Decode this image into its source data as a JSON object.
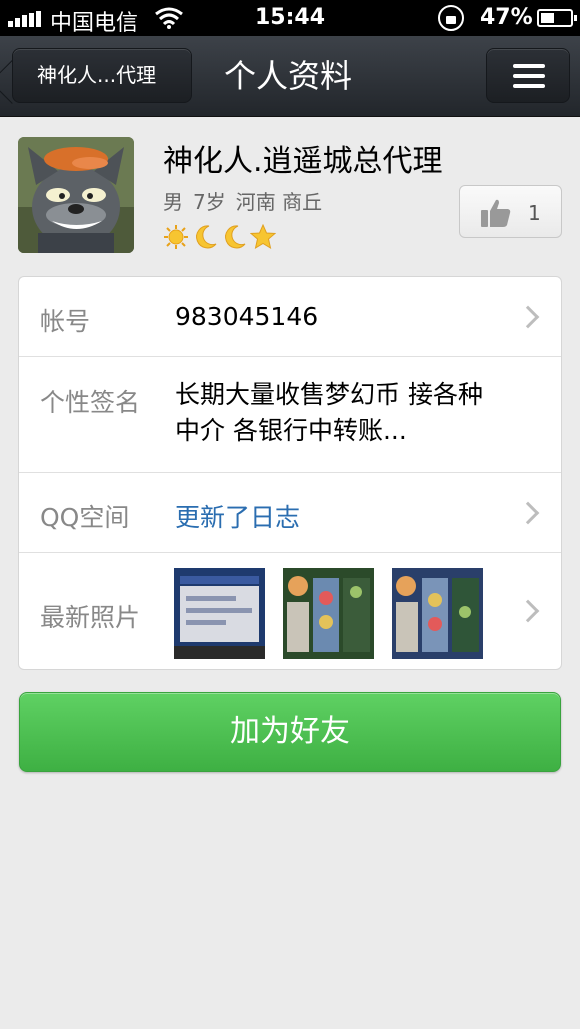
{
  "status_bar": {
    "carrier": "中国电信",
    "time": "15:44",
    "battery_percent": "47%",
    "battery_level": 0.47
  },
  "nav": {
    "back_label": "神化人...代理",
    "title": "个人资料",
    "menu_icon": "menu-icon"
  },
  "profile": {
    "name": "神化人.逍遥城总代理",
    "gender": "男",
    "age": "7岁",
    "location": "河南 商丘",
    "level_icons": [
      "sun-icon",
      "moon-icon",
      "moon-icon",
      "star-icon"
    ],
    "like_count": "1"
  },
  "details": {
    "account_label": "帐号",
    "account_value": "983045146",
    "signature_label": "个性签名",
    "signature_value": " 长期大量收售梦幻币 接各种中介 各银行中转账...",
    "qzone_label": "QQ空间",
    "qzone_value": "更新了日志",
    "photos_label": "最新照片",
    "photos": [
      "photo-thumbnail-1",
      "photo-thumbnail-2",
      "photo-thumbnail-3"
    ]
  },
  "actions": {
    "add_friend_label": "加为好友"
  },
  "colors": {
    "accent_green": "#4cc252",
    "link_blue": "#2a6db0",
    "nav_dark": "#2c3036"
  }
}
